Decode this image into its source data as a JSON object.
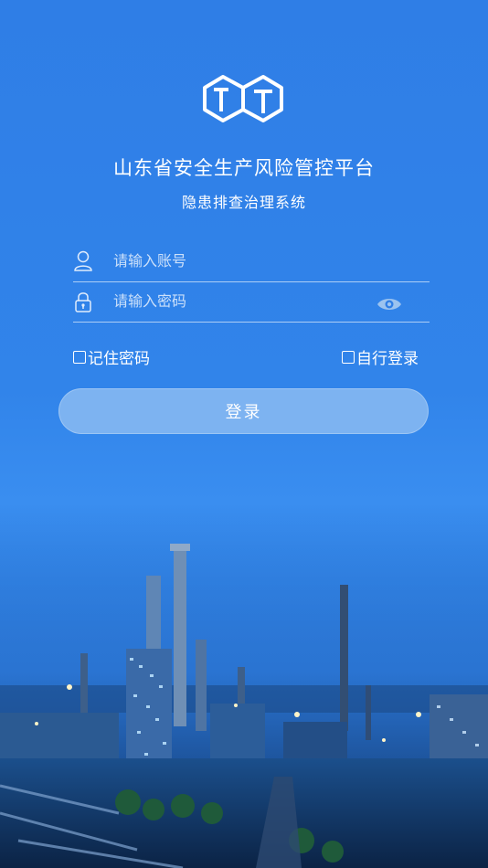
{
  "header": {
    "title": "山东省安全生产风险管控平台",
    "subtitle": "隐患排查治理系统"
  },
  "form": {
    "account_placeholder": "请输入账号",
    "password_placeholder": "请输入密码",
    "remember_label": "记住密码",
    "auto_login_label": "自行登录",
    "login_label": "登录"
  },
  "icons": {
    "logo": "cube-logo-icon",
    "account": "user-icon",
    "password": "lock-icon",
    "show_password": "eye-icon"
  },
  "colors": {
    "background": "#2f7ee6",
    "button": "#7db3f1",
    "text": "#ffffff"
  }
}
